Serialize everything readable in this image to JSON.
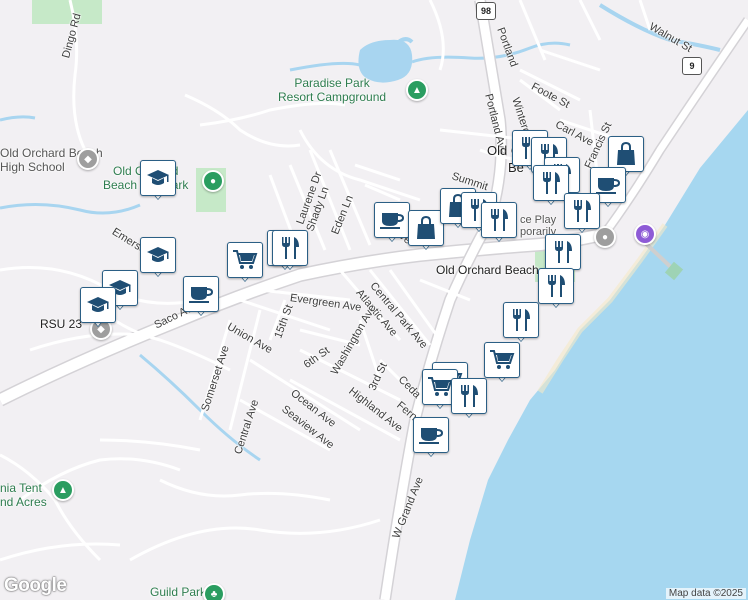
{
  "map": {
    "streets": [
      {
        "id": "dingo-rd",
        "text": "Dingo Rd"
      },
      {
        "id": "portland-top",
        "text": "Portland"
      },
      {
        "id": "walnut-st",
        "text": "Walnut St"
      },
      {
        "id": "foote-st",
        "text": "Foote St"
      },
      {
        "id": "wintergreen",
        "text": "Wintergreen"
      },
      {
        "id": "carl-ave",
        "text": "Carl Ave"
      },
      {
        "id": "portland-ave",
        "text": "Portland Ave"
      },
      {
        "id": "francis-st",
        "text": "Francis St"
      },
      {
        "id": "saco-ave",
        "text": "Saco Ave"
      },
      {
        "id": "union-ave",
        "text": "Union Ave"
      },
      {
        "id": "15th-st",
        "text": "15th St"
      },
      {
        "id": "evergreen-ave",
        "text": "Evergreen Ave"
      },
      {
        "id": "atlantic-ave",
        "text": "Atlantic Ave"
      },
      {
        "id": "central-park-ave",
        "text": "Central Park Ave"
      },
      {
        "id": "fern-ave-top",
        "text": "Fern Ave"
      },
      {
        "id": "shady-ln",
        "text": "Shady Ln"
      },
      {
        "id": "eden-ln",
        "text": "Eden Ln"
      },
      {
        "id": "laurene-dr",
        "text": "Laurene Dr"
      },
      {
        "id": "emerson",
        "text": "Emerson"
      },
      {
        "id": "somerset-ave",
        "text": "Somerset Ave"
      },
      {
        "id": "6th-st",
        "text": "6th St"
      },
      {
        "id": "washington-ave",
        "text": "Washington Ave"
      },
      {
        "id": "ocean-ave",
        "text": "Ocean Ave"
      },
      {
        "id": "seaview-ave",
        "text": "Seaview Ave"
      },
      {
        "id": "central-ave",
        "text": "Central Ave"
      },
      {
        "id": "highland-ave",
        "text": "Highland Ave"
      },
      {
        "id": "3rd-st",
        "text": "3rd St"
      },
      {
        "id": "cedar",
        "text": "Ceda"
      },
      {
        "id": "fern-av",
        "text": "Fern Av"
      },
      {
        "id": "w-grand-ave",
        "text": "W Grand Ave"
      },
      {
        "id": "summit",
        "text": "Summit"
      }
    ],
    "places": [
      {
        "id": "oob-town",
        "text": "Old Orchard"
      },
      {
        "id": "oob-be",
        "text": "Be"
      },
      {
        "id": "oob-beach",
        "text": "Old Orchard Beach"
      },
      {
        "id": "rsu",
        "text": "RSU 23"
      }
    ],
    "pois": [
      {
        "id": "paradise",
        "line1": "Paradise Park",
        "line2": "Resort Campground"
      },
      {
        "id": "oobhs",
        "line1": "Old Orchard Beach",
        "line2": "High School"
      },
      {
        "id": "oob-park",
        "line1": "Old Orchard",
        "line2": "Beach Ball Park"
      },
      {
        "id": "tent",
        "line1": "nia Tent",
        "line2": "nd Acres"
      },
      {
        "id": "guild",
        "line1": "Guild Park",
        "line2": ""
      },
      {
        "id": "pier",
        "line1": "ce Play",
        "line2": "porarily"
      }
    ],
    "route_shields": [
      {
        "id": "rt98",
        "text": "98"
      },
      {
        "id": "rt9",
        "text": "9"
      }
    ],
    "markers": [
      {
        "icon": "school-icon"
      },
      {
        "icon": "school-icon"
      },
      {
        "icon": "school-icon"
      },
      {
        "icon": "school-icon"
      },
      {
        "icon": "coffee-icon"
      },
      {
        "icon": "grocery-cart-icon"
      },
      {
        "icon": "restaurant-icon"
      },
      {
        "icon": "restaurant-icon"
      },
      {
        "icon": "coffee-icon"
      },
      {
        "icon": "shopping-bag-icon"
      },
      {
        "icon": "shopping-bag-icon"
      },
      {
        "icon": "restaurant-icon"
      },
      {
        "icon": "restaurant-icon"
      },
      {
        "icon": "restaurant-icon"
      },
      {
        "icon": "restaurant-icon"
      },
      {
        "icon": "restaurant-icon"
      },
      {
        "icon": "restaurant-icon"
      },
      {
        "icon": "shopping-bag-icon"
      },
      {
        "icon": "coffee-icon"
      },
      {
        "icon": "restaurant-icon"
      },
      {
        "icon": "restaurant-icon"
      },
      {
        "icon": "restaurant-icon"
      },
      {
        "icon": "restaurant-icon"
      },
      {
        "icon": "grocery-cart-icon"
      },
      {
        "icon": "grocery-cart-icon"
      },
      {
        "icon": "grocery-cart-icon"
      },
      {
        "icon": "restaurant-icon"
      },
      {
        "icon": "coffee-icon"
      }
    ],
    "attribution": "Map data ©2025",
    "logo": "Google"
  },
  "colors": {
    "land": "#f2f0f3",
    "water": "#a8d5f0",
    "ocean": "#a6d7f0",
    "park": "#c6e9c8",
    "road": "#ffffff",
    "road_edge": "#d4d2d6",
    "marker_icon": "#1f4e74",
    "poi_green": "#2e7d4f",
    "pin_camp": "#2a9d60",
    "pin_photo": "#8e5bd6"
  }
}
